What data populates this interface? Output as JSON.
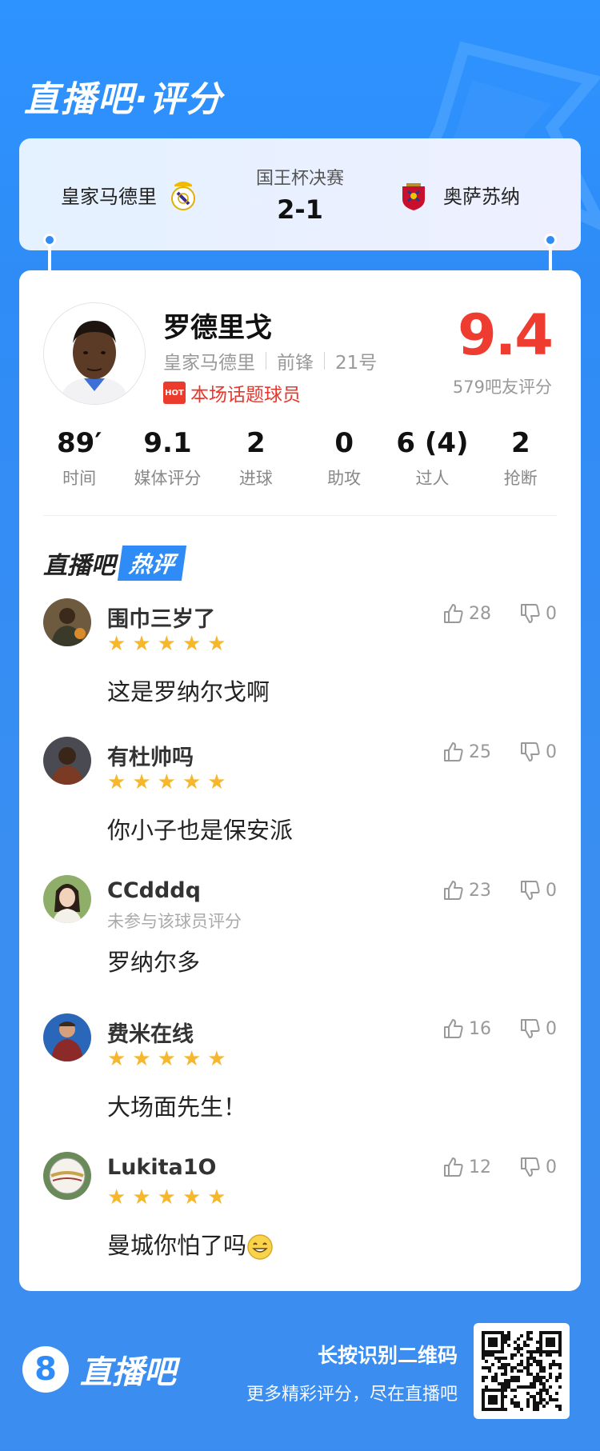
{
  "brand_title": "直播吧·评分",
  "match": {
    "home_team": "皇家马德里",
    "away_team": "奥萨苏纳",
    "competition": "国王杯决赛",
    "score": "2-1"
  },
  "player": {
    "name": "罗德里戈",
    "team": "皇家马德里",
    "position": "前锋",
    "number": "21号",
    "hot_label": "本场话题球员",
    "hot_badge": "HOT",
    "rating": "9.4",
    "fan_count": "579吧友评分"
  },
  "stats": [
    {
      "value": "89′",
      "label": "时间"
    },
    {
      "value": "9.1",
      "label": "媒体评分"
    },
    {
      "value": "2",
      "label": "进球"
    },
    {
      "value": "0",
      "label": "助攻"
    },
    {
      "value": "6 (4)",
      "label": "过人"
    },
    {
      "value": "2",
      "label": "抢断"
    }
  ],
  "section": {
    "title_a": "直播吧",
    "title_b": "热评"
  },
  "comments": [
    {
      "user": "围巾三岁了",
      "text": "这是罗纳尔戈啊",
      "likes": "28",
      "dislikes": "0",
      "stars": 5
    },
    {
      "user": "有杜帅吗",
      "text": "你小子也是保安派",
      "likes": "25",
      "dislikes": "0",
      "stars": 5
    },
    {
      "user": "CCdddq",
      "note": "未参与该球员评分",
      "text": "罗纳尔多",
      "likes": "23",
      "dislikes": "0"
    },
    {
      "user": "费米在线",
      "text": "大场面先生！",
      "likes": "16",
      "dislikes": "0",
      "stars": 5
    },
    {
      "user": "Lukita1O",
      "text": "曼城你怕了吗",
      "likes": "12",
      "dislikes": "0",
      "stars": 5
    }
  ],
  "footer": {
    "logo_digit": "8",
    "logo_text": "直播吧",
    "slogan_1": "长按识别二维码",
    "slogan_2": "更多精彩评分，尽在直播吧"
  },
  "colors": {
    "primary": "#2f8cf6",
    "rating": "#ee3c31",
    "star": "#f6b72c",
    "hot": "#e8372c"
  },
  "icons": [
    "thumbs-up-icon",
    "thumbs-down-icon",
    "star-icon",
    "hot-badge-icon",
    "qr-code",
    "grin-emoji"
  ]
}
